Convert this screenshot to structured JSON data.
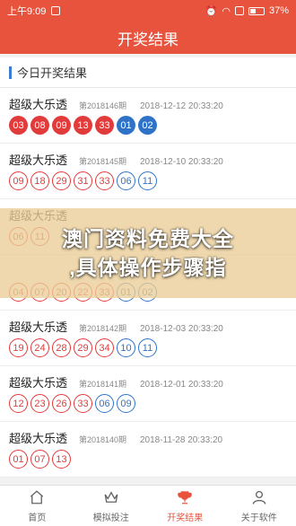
{
  "status": {
    "time": "上午9:09",
    "battery": "37%"
  },
  "title": "开奖结果",
  "section_title": "今日开奖结果",
  "colors": {
    "red": "#e23b3b",
    "blue": "#2f73c9",
    "brand": "#e8533e"
  },
  "rows": [
    {
      "name": "超级大乐透",
      "issue": "第2018146期",
      "time": "2018-12-12 20:33:20",
      "filled": true,
      "reds": [
        "03",
        "08",
        "09",
        "13",
        "33"
      ],
      "blues": [
        "01",
        "02"
      ]
    },
    {
      "name": "超级大乐透",
      "issue": "第2018145期",
      "time": "2018-12-10 20:33:20",
      "filled": false,
      "reds": [
        "09",
        "18",
        "29",
        "31",
        "33"
      ],
      "blues": [
        "06",
        "11"
      ]
    },
    {
      "name": "超级大乐透",
      "issue": "",
      "time": "",
      "filled": false,
      "reds": [
        "06",
        "11",
        "",
        "",
        ""
      ],
      "blues": [
        "",
        ""
      ]
    },
    {
      "name": "",
      "issue": "",
      "time": "",
      "filled": false,
      "reds": [
        "04",
        "07",
        "20",
        "22",
        "33"
      ],
      "blues": [
        "01",
        "02"
      ]
    },
    {
      "name": "超级大乐透",
      "issue": "第2018142期",
      "time": "2018-12-03 20:33:20",
      "filled": false,
      "reds": [
        "19",
        "24",
        "28",
        "29",
        "34"
      ],
      "blues": [
        "10",
        "11"
      ]
    },
    {
      "name": "超级大乐透",
      "issue": "第2018141期",
      "time": "2018-12-01 20:33:20",
      "filled": false,
      "reds": [
        "12",
        "23",
        "26",
        "33"
      ],
      "blues": [
        "06",
        "09"
      ]
    },
    {
      "name": "超级大乐透",
      "issue": "第2018140期",
      "time": "2018-11-28 20:33:20",
      "filled": false,
      "reds": [
        "01",
        "07",
        "13"
      ],
      "blues": []
    }
  ],
  "overlay": {
    "line1": "澳门资料免费大全",
    "line2": ",具体操作步骤指"
  },
  "tabs": [
    {
      "label": "首页",
      "icon": "home-icon",
      "active": false
    },
    {
      "label": "模拟投注",
      "icon": "crown-icon",
      "active": false
    },
    {
      "label": "开奖结果",
      "icon": "trophy-icon",
      "active": true
    },
    {
      "label": "关于软件",
      "icon": "person-icon",
      "active": false
    }
  ]
}
